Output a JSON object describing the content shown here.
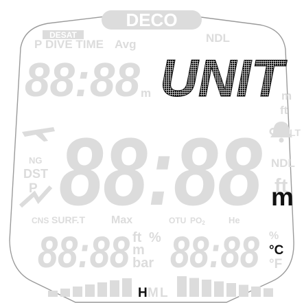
{
  "display": {
    "colors": {
      "ghost": "#dcdcdc",
      "active": "#111111",
      "frame": "#9a9a9a",
      "background": "#ffffff"
    },
    "top": {
      "deco_badge": "DECO",
      "desat": "DESAT",
      "p": "P",
      "dive_time": "DIVE TIME",
      "avg": "Avg",
      "ndl": "NDL",
      "left_digits": "88:88",
      "left_unit": "m",
      "unit_text": "UNIT",
      "right_unit_m": "m",
      "right_unit_ft": "ft"
    },
    "middle": {
      "airplane_icon": "airplane-icon",
      "ng": "NG",
      "dst": "DST",
      "p": "P",
      "trend_icon": "ascent-trend-icon",
      "main_digits": "88:88",
      "degree": "°",
      "bell_icon": "bell-icon",
      "lt": "LT",
      "ndl": "NDL",
      "unit_ft": "ft",
      "unit_m": "m"
    },
    "bottom": {
      "cns": "CNS",
      "surf_t": "SURF.T",
      "max": "Max",
      "otu": "OTU",
      "po2": "PO",
      "po2_sub": "2",
      "he": "He",
      "left_digits": "88:88",
      "unit_ft": "ft",
      "unit_percent": "%",
      "unit_m": "m",
      "unit_bar": "bar",
      "right_digits": "88:88",
      "unit_percent_right": "%",
      "unit_c": "°C",
      "unit_f": "°F"
    },
    "bargraph": {
      "left_segments": 7,
      "right_segments": 8,
      "h": "H",
      "m": "M",
      "l": "L",
      "active_level": "H"
    }
  }
}
